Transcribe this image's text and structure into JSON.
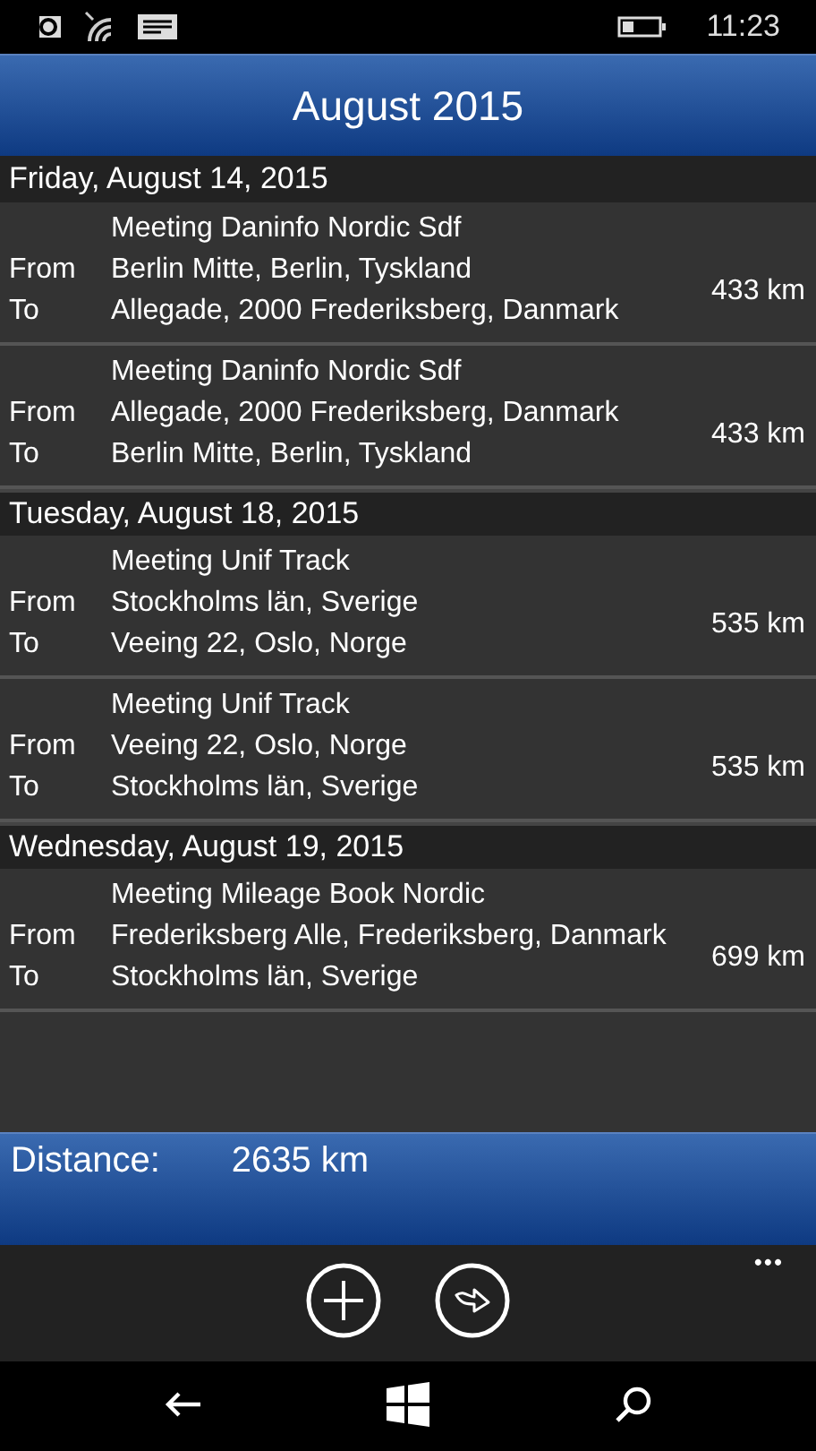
{
  "status_bar": {
    "time": "11:23"
  },
  "header": {
    "title": "August 2015"
  },
  "days": [
    {
      "date": "Friday, August 14, 2015",
      "trips": [
        {
          "title": "Meeting Daninfo Nordic Sdf",
          "from_label": "From",
          "from": "Berlin Mitte, Berlin, Tyskland",
          "to_label": "To",
          "to": "Allegade, 2000 Frederiksberg, Danmark",
          "distance": "433 km"
        },
        {
          "title": "Meeting Daninfo Nordic Sdf",
          "from_label": "From",
          "from": "Allegade, 2000 Frederiksberg, Danmark",
          "to_label": "To",
          "to": "Berlin Mitte, Berlin, Tyskland",
          "distance": "433 km"
        }
      ]
    },
    {
      "date": "Tuesday, August 18, 2015",
      "trips": [
        {
          "title": "Meeting Unif Track",
          "from_label": "From",
          "from": "Stockholms län, Sverige",
          "to_label": "To",
          "to": "Veeing 22, Oslo, Norge",
          "distance": "535 km"
        },
        {
          "title": "Meeting Unif Track",
          "from_label": "From",
          "from": "Veeing 22, Oslo, Norge",
          "to_label": "To",
          "to": "Stockholms län, Sverige",
          "distance": "535 km"
        }
      ]
    },
    {
      "date": "Wednesday, August 19, 2015",
      "trips": [
        {
          "title": "Meeting Mileage Book Nordic",
          "from_label": "From",
          "from": "Frederiksberg Alle, Frederiksberg, Danmark",
          "to_label": "To",
          "to": "Stockholms län, Sverige",
          "distance": "699 km"
        }
      ]
    }
  ],
  "summary": {
    "label": "Distance:",
    "value": "2635 km"
  },
  "app_bar": {
    "more": "•••"
  }
}
